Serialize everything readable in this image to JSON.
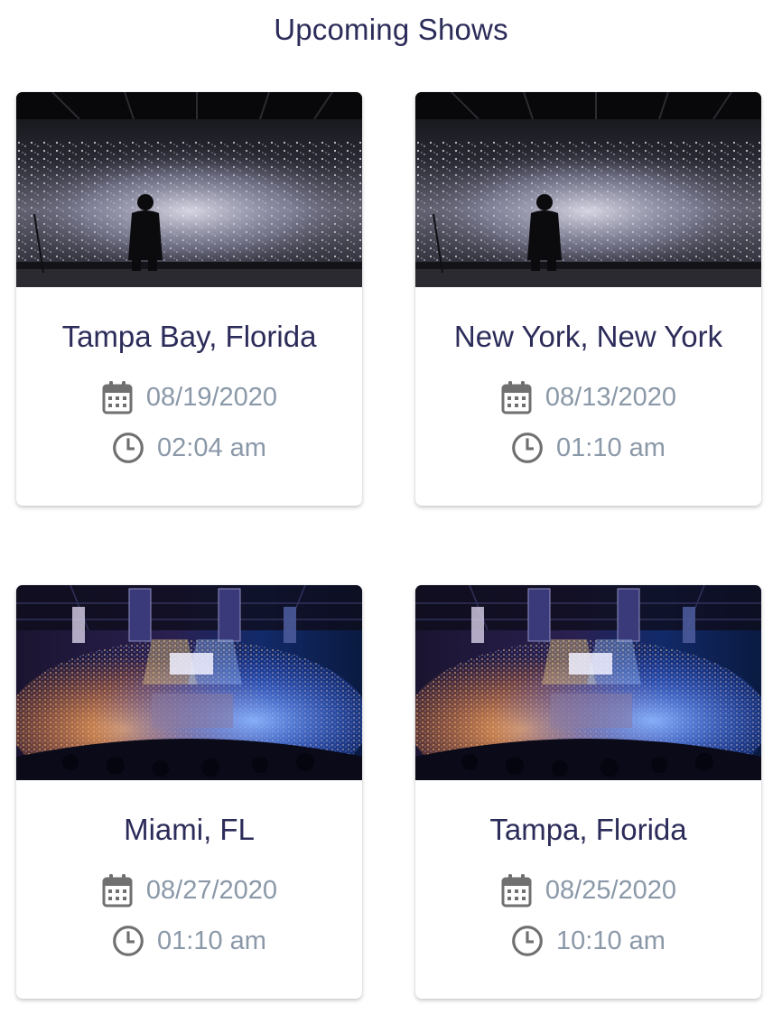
{
  "page": {
    "title": "Upcoming Shows"
  },
  "colors": {
    "title": "#2c2c5a",
    "meta_text": "#8a98a8",
    "icon": "#707070"
  },
  "shows": [
    {
      "city": "Tampa Bay, Florida",
      "date": "08/19/2020",
      "time": "02:04 am",
      "image": "concert-crowd-phone-lights",
      "date_icon": "calendar-icon",
      "time_icon": "clock-icon"
    },
    {
      "city": "New York, New York",
      "date": "08/13/2020",
      "time": "01:10 am",
      "image": "concert-crowd-phone-lights",
      "date_icon": "calendar-icon",
      "time_icon": "clock-icon"
    },
    {
      "city": "Miami, FL",
      "date": "08/27/2020",
      "time": "01:10 am",
      "image": "arena-stage-lights",
      "date_icon": "calendar-icon",
      "time_icon": "clock-icon"
    },
    {
      "city": "Tampa, Florida",
      "date": "08/25/2020",
      "time": "10:10 am",
      "image": "arena-stage-lights",
      "date_icon": "calendar-icon",
      "time_icon": "clock-icon"
    }
  ]
}
